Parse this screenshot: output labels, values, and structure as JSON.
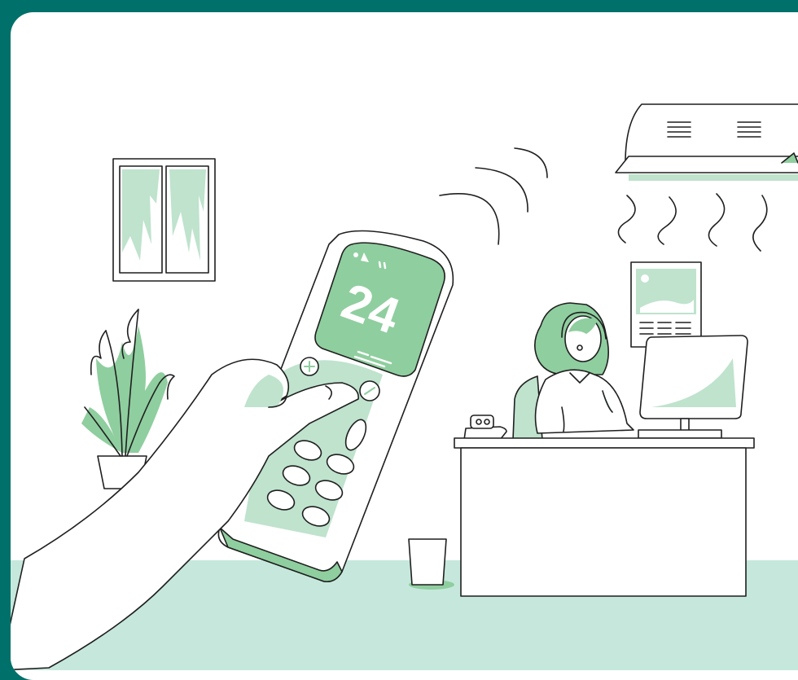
{
  "remote": {
    "temperature": "24"
  },
  "colors": {
    "frame": "#00706a",
    "card": "#ffffff",
    "floor": "#c6e8dc",
    "accent_light": "#bfe3cd",
    "accent_mid": "#8fce9f",
    "ink": "#1f1f1f"
  },
  "icons": [
    "remote-control-icon",
    "air-conditioner-icon",
    "wifi-signal-icon",
    "plant-icon",
    "window-icon",
    "monitor-icon",
    "telephone-icon",
    "waste-bin-icon",
    "headset-icon"
  ]
}
